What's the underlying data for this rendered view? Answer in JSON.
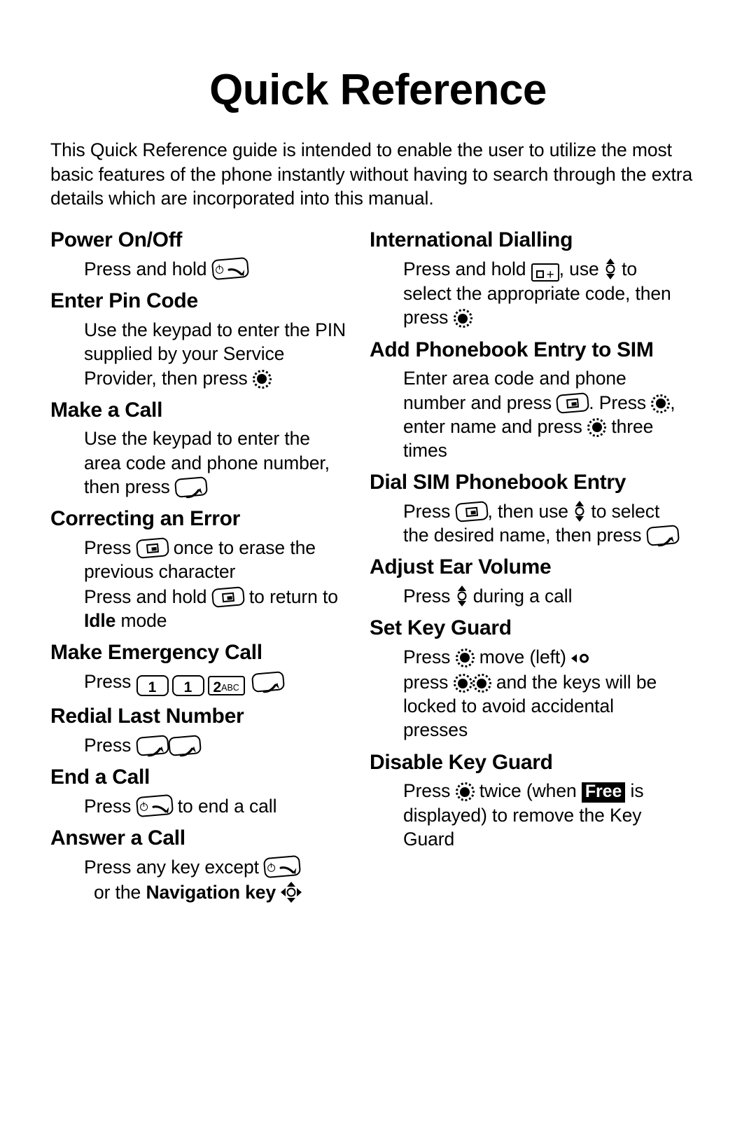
{
  "document": {
    "title": "Quick Reference",
    "intro": "This Quick Reference guide is intended to enable the user to utilize the most basic features of the phone instantly without having to search through the extra details which are incorporated into this manual."
  },
  "left_column": {
    "sections": [
      {
        "heading": "Power On/Off",
        "lines": [
          {
            "pre": "Press and hold ",
            "icon": "power-end-key",
            "post": ""
          }
        ]
      },
      {
        "heading": "Enter Pin Code",
        "lines": [
          {
            "pre": "Use the keypad to enter the PIN supplied by your Service Provider, then press ",
            "icon": "ok-select-key",
            "post": ""
          }
        ]
      },
      {
        "heading": "Make a Call",
        "lines": [
          {
            "pre": "Use the keypad to enter the area code and phone number, then press ",
            "icon": "send-call-key",
            "post": ""
          }
        ]
      },
      {
        "heading": "Correcting an Error",
        "lines": [
          {
            "pre": "Press ",
            "icon": "clear-key",
            "post": " once to erase the previous character"
          },
          {
            "pre": "Press and hold ",
            "icon": "clear-key",
            "post": " to return to ",
            "bold": "Idle",
            "tail": " mode"
          }
        ]
      },
      {
        "heading": "Make Emergency Call",
        "lines": [
          {
            "pre": "Press ",
            "keys": [
              "1",
              "1",
              "2ABC"
            ],
            "icon": "send-call-key",
            "post": ""
          }
        ]
      },
      {
        "heading": "Redial Last Number",
        "lines": [
          {
            "pre": "Press ",
            "icon": "send-call-key",
            "icon2": "send-call-key",
            "post": ""
          }
        ]
      },
      {
        "heading": "End a Call",
        "lines": [
          {
            "pre": "Press ",
            "icon": "power-end-key",
            "post": " to end a call"
          }
        ]
      },
      {
        "heading": "Answer a Call",
        "lines": [
          {
            "pre": "Press any key except ",
            "icon": "power-end-key",
            "post": ""
          },
          {
            "pre": "or the ",
            "bold": "Navigation key",
            "icon": "navigation-key",
            "post": ""
          }
        ]
      }
    ]
  },
  "right_column": {
    "sections": [
      {
        "heading": "International Dialling",
        "lines": [
          {
            "pre": "Press and hold ",
            "icon": "zero-plus-key",
            "mid": ", use ",
            "icon2": "up-down-nav-key",
            "post": " to select the appropriate code, then press ",
            "icon3": "ok-select-key"
          }
        ]
      },
      {
        "heading": "Add Phonebook Entry to SIM",
        "lines": [
          {
            "pre": "Enter area code and phone number and press ",
            "icon": "clear-key",
            "mid": ". Press ",
            "icon2": "ok-select-key",
            "post": ", enter name and press ",
            "icon3": "ok-select-key",
            "tail": " three times"
          }
        ]
      },
      {
        "heading": "Dial SIM Phonebook Entry",
        "lines": [
          {
            "pre": "Press ",
            "icon": "clear-key",
            "mid": ", then use ",
            "icon2": "up-down-nav-key",
            "post": " to select the desired name, then press ",
            "icon3": "send-call-key"
          }
        ]
      },
      {
        "heading": "Adjust Ear Volume",
        "lines": [
          {
            "pre": "Press ",
            "icon": "up-down-nav-key",
            "post": " during a call"
          }
        ]
      },
      {
        "heading": "Set Key Guard",
        "lines": [
          {
            "pre": "Press ",
            "icon": "ok-select-key",
            "mid": " move (left) ",
            "icon2": "move-left-key",
            "post": ""
          },
          {
            "pre": "press ",
            "icon": "ok-select-key",
            "icon2": "ok-select-key",
            "post": " and the keys will be locked to avoid accidental presses"
          }
        ]
      },
      {
        "heading": "Disable Key Guard",
        "lines": [
          {
            "pre": "Press ",
            "icon": "ok-select-key",
            "mid": " twice (when ",
            "badge": "Free",
            "post": " is displayed) to remove the Key Guard"
          }
        ]
      }
    ]
  },
  "key_icons": {
    "power_end_key": "power-end-key",
    "send_call_key": "send-call-key",
    "ok_select_key": "ok-select-key",
    "clear_key": "clear-key",
    "up_down_nav_key": "up-down-nav-key",
    "navigation_key": "navigation-key",
    "move_left_key": "move-left-key",
    "zero_plus_key": "zero-plus-key",
    "key_1_label": "1",
    "key_2_digit": "2",
    "key_2_letters": "ABC",
    "zero_plus_label": "+"
  },
  "colors": {
    "ink": "#000000",
    "paper": "#ffffff"
  }
}
